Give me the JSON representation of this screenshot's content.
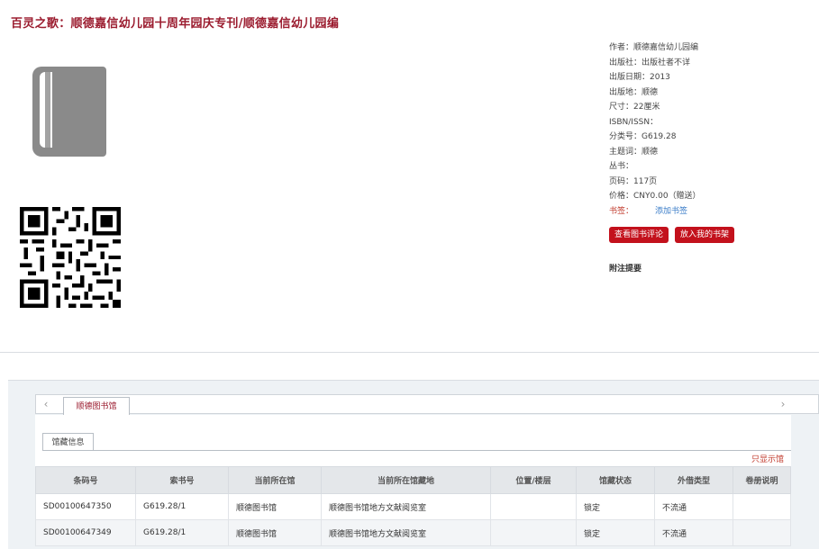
{
  "title": "百灵之歌：顺德嘉信幼儿园十周年园庆专刊/顺德嘉信幼儿园编",
  "cover_icon": "book-icon",
  "qr_icon": "qr-code-icon",
  "meta": {
    "author": "作者：顺德嘉信幼儿园编",
    "publisher": "出版社：出版社者不详",
    "pub_date": "出版日期：2013",
    "pub_place": "出版地：顺德",
    "size": "尺寸：22厘米",
    "isbn": "ISBN/ISSN：",
    "class_no": "分类号：G619.28",
    "subject": "主题词：顺德",
    "series": "丛书：",
    "pages": "页码：117页",
    "price": "价格：CNY0.00（赠送）",
    "tag_label": "书签：",
    "tag_link": "添加书签"
  },
  "buttons": {
    "review": "查看图书评论",
    "shelf": "放入我的书架"
  },
  "notes_title": "附注提要",
  "library_tab": "顺德图书馆",
  "sub_tab": "馆藏信息",
  "only_show": "只显示馆",
  "table": {
    "headers": [
      "条码号",
      "索书号",
      "当前所在馆",
      "当前所在馆藏地",
      "位置/楼层",
      "馆藏状态",
      "外借类型",
      "卷册说明"
    ],
    "rows": [
      [
        "SD00100647350",
        "G619.28/1",
        "顺德图书馆",
        "顺德图书馆地方文献阅览室",
        "",
        "锁定",
        "不流通",
        ""
      ],
      [
        "SD00100647349",
        "G619.28/1",
        "顺德图书馆",
        "顺德图书馆地方文献阅览室",
        "",
        "锁定",
        "不流通",
        ""
      ]
    ]
  },
  "colors": {
    "accent": "#9b1c2f",
    "button": "#c3111c",
    "link": "#3a7cc8"
  }
}
